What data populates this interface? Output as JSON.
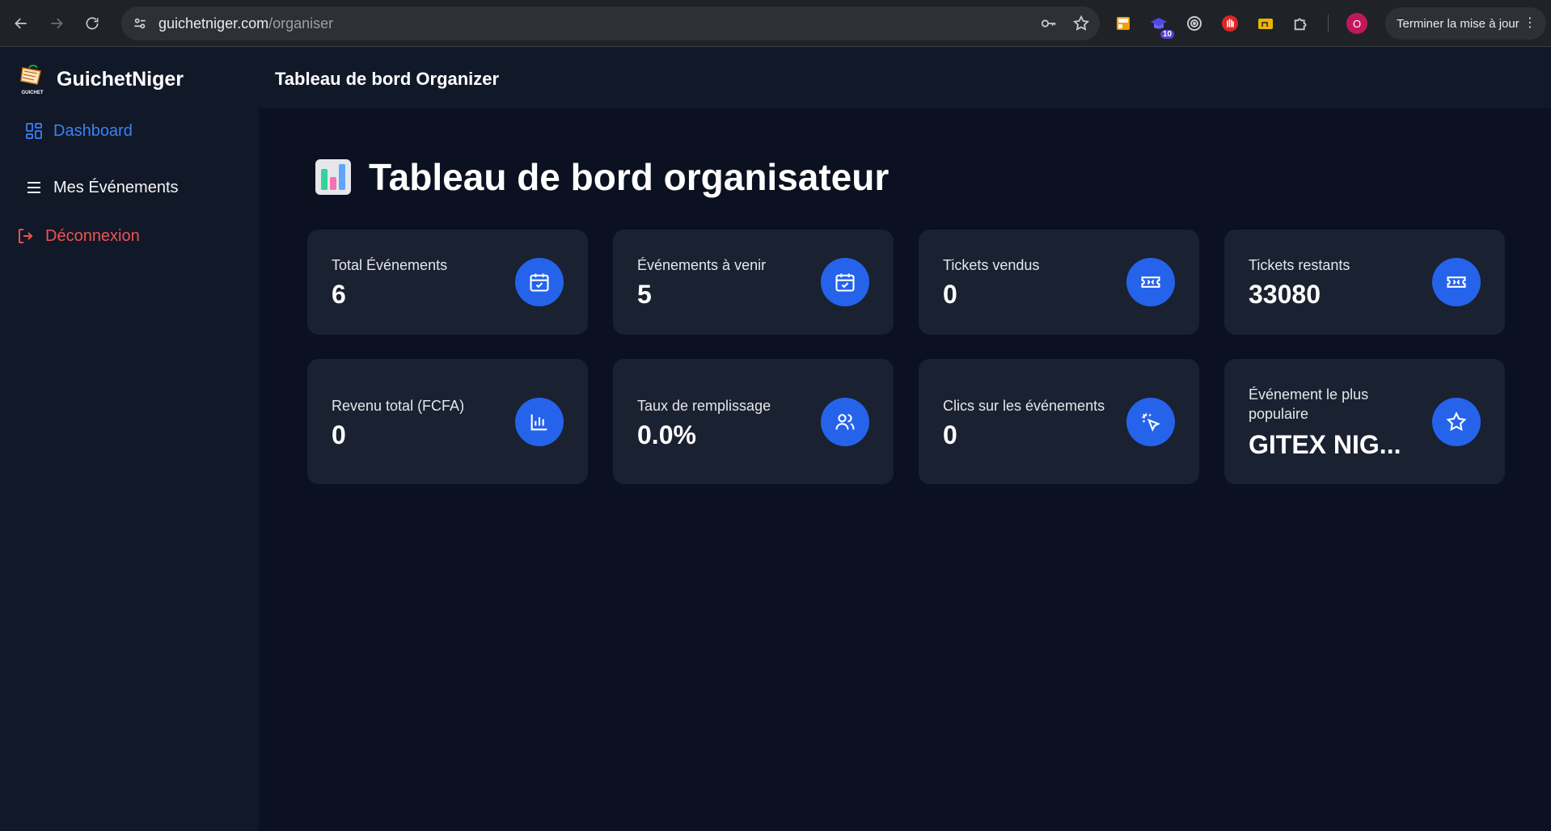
{
  "browser": {
    "url_host": "guichetniger.com",
    "url_path": "/organiser",
    "update_button": "Terminer la mise à jour",
    "profile_initial": "O",
    "extension_badge": "10"
  },
  "sidebar": {
    "brand": "GuichetNiger",
    "logo_text": "GUICHET",
    "items": [
      {
        "label": "Dashboard",
        "icon": "dashboard-grid-icon",
        "active": true
      },
      {
        "label": "Mes Événements",
        "icon": "menu-lines-icon"
      },
      {
        "label": "Déconnexion",
        "icon": "logout-icon"
      }
    ]
  },
  "header": {
    "title": "Tableau de bord Organizer"
  },
  "main": {
    "title": "Tableau de bord organisateur",
    "title_icon": "bar-chart-emoji-icon",
    "cards": [
      {
        "label": "Total Événements",
        "value": "6",
        "icon": "calendar-check-icon"
      },
      {
        "label": "Événements à venir",
        "value": "5",
        "icon": "calendar-check-icon"
      },
      {
        "label": "Tickets vendus",
        "value": "0",
        "icon": "ticket-icon"
      },
      {
        "label": "Tickets restants",
        "value": "33080",
        "icon": "ticket-icon"
      },
      {
        "label": "Revenu total (FCFA)",
        "value": "0",
        "icon": "bar-chart-icon"
      },
      {
        "label": "Taux de remplissage",
        "value": "0.0%",
        "icon": "users-icon"
      },
      {
        "label": "Clics sur les événements",
        "value": "0",
        "icon": "cursor-click-icon"
      },
      {
        "label": "Événement le plus populaire",
        "value": "GITEX NIG...",
        "icon": "star-icon"
      }
    ]
  },
  "colors": {
    "accent": "#2563eb",
    "active_link": "#3b82f6",
    "logout": "#f05252",
    "card_bg": "#1a2130",
    "page_bg": "#0b1120",
    "sidebar_bg": "#111827"
  }
}
